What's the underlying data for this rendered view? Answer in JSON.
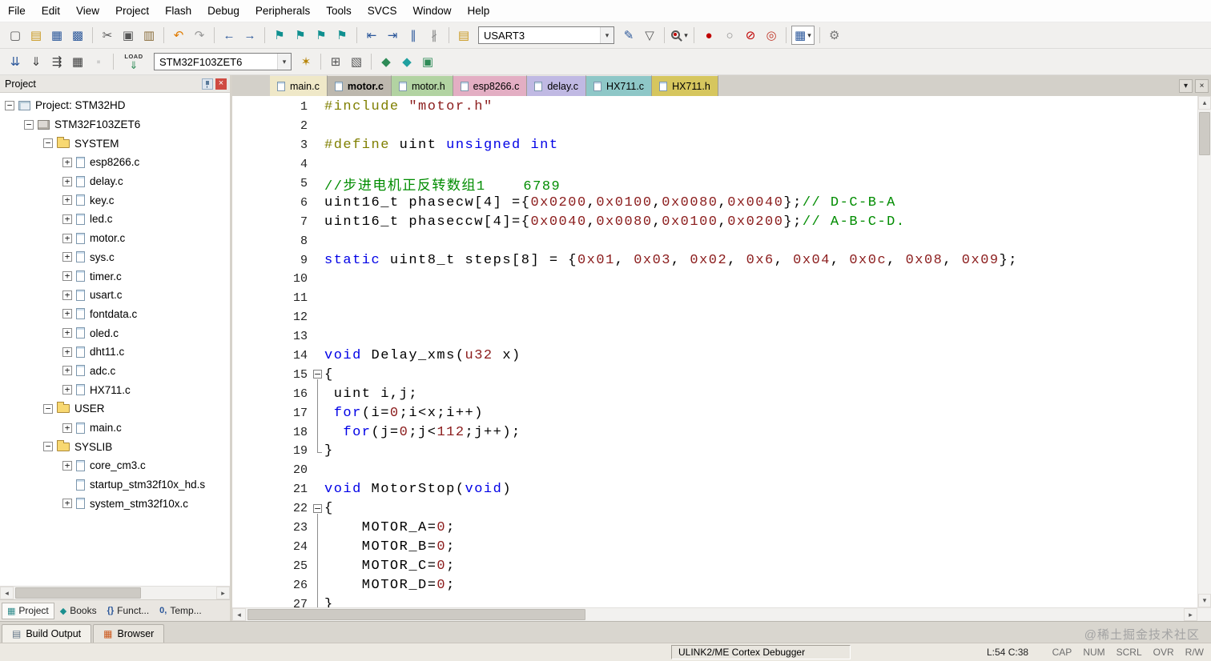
{
  "menu": {
    "items": [
      "File",
      "Edit",
      "View",
      "Project",
      "Flash",
      "Debug",
      "Peripherals",
      "Tools",
      "SVCS",
      "Window",
      "Help"
    ]
  },
  "toolbar_main": {
    "left_icons": [
      {
        "name": "new-file-icon",
        "glyph": "▢",
        "color": "#5a5a5a"
      },
      {
        "name": "open-folder-icon",
        "glyph": "▤",
        "color": "#c9971c"
      },
      {
        "name": "save-icon",
        "glyph": "▦",
        "color": "#2b579a"
      },
      {
        "name": "save-all-icon",
        "glyph": "▩",
        "color": "#2b579a"
      },
      {
        "sep": true
      },
      {
        "name": "cut-icon",
        "glyph": "✂",
        "color": "#555555"
      },
      {
        "name": "copy-icon",
        "glyph": "▣",
        "color": "#555555"
      },
      {
        "name": "paste-icon",
        "glyph": "▥",
        "color": "#8a6d3b"
      },
      {
        "sep": true
      },
      {
        "name": "undo-icon",
        "glyph": "↶",
        "color": "#e07b00"
      },
      {
        "name": "redo-icon",
        "glyph": "↷",
        "color": "#999999"
      },
      {
        "sep": true
      },
      {
        "name": "navigate-back-icon",
        "glyph": "←",
        "color": "#2b579a"
      },
      {
        "name": "navigate-forward-icon",
        "glyph": "→",
        "color": "#2b579a"
      },
      {
        "sep": true
      },
      {
        "name": "bookmark-toggle-icon",
        "glyph": "⚑",
        "color": "#0e8f8f"
      },
      {
        "name": "bookmark-prev-icon",
        "glyph": "⚑",
        "color": "#0e8f8f"
      },
      {
        "name": "bookmark-next-icon",
        "glyph": "⚑",
        "color": "#0e8f8f"
      },
      {
        "name": "bookmark-clear-all-icon",
        "glyph": "⚑",
        "color": "#0e8f8f"
      },
      {
        "sep": true
      },
      {
        "name": "unindent-icon",
        "glyph": "⇤",
        "color": "#2b579a"
      },
      {
        "name": "indent-icon",
        "glyph": "⇥",
        "color": "#2b579a"
      },
      {
        "name": "comment-selection-icon",
        "glyph": "∥",
        "color": "#2b579a"
      },
      {
        "name": "uncomment-selection-icon",
        "glyph": "∦",
        "color": "#888888"
      },
      {
        "sep": true
      },
      {
        "name": "serial-port-icon",
        "glyph": "▤",
        "color": "#c9971c"
      }
    ],
    "serial_combo": {
      "value": "USART3"
    },
    "right_icons": [
      {
        "name": "configure-flags-icon",
        "glyph": "✎",
        "color": "#2b579a"
      },
      {
        "name": "analysis-windows-icon",
        "glyph": "▽",
        "color": "#555555"
      },
      {
        "sep": true
      },
      {
        "name": "find-in-files-icon",
        "glyph": "MAG",
        "color": "#555555",
        "drop": true
      },
      {
        "sep": true
      },
      {
        "name": "insert-breakpoint-icon",
        "glyph": "●",
        "color": "#c00000"
      },
      {
        "name": "enable-breakpoint-icon",
        "glyph": "○",
        "color": "#8a8a8a"
      },
      {
        "name": "disable-all-breakpoints-icon",
        "glyph": "⊘",
        "color": "#c00000"
      },
      {
        "name": "kill-all-breakpoints-icon",
        "glyph": "◎",
        "color": "#c0392b"
      },
      {
        "sep": true
      },
      {
        "name": "debug-windows-icon",
        "glyph": "▦",
        "color": "#2b579a",
        "drop": true,
        "boxed": true
      },
      {
        "sep": true
      },
      {
        "name": "configure-target-icon",
        "glyph": "⚙",
        "color": "#777777"
      }
    ]
  },
  "toolbar_build": {
    "left_icons": [
      {
        "name": "translate-file-icon",
        "glyph": "⇊",
        "color": "#2b579a"
      },
      {
        "name": "build-icon",
        "glyph": "⇓",
        "color": "#3a3a3a"
      },
      {
        "name": "rebuild-all-icon",
        "glyph": "⇶",
        "color": "#3a3a3a"
      },
      {
        "name": "batch-build-icon",
        "glyph": "▦",
        "color": "#3a3a3a"
      },
      {
        "name": "stop-build-icon",
        "glyph": "▪",
        "color": "#9a9a9a",
        "disabled": true
      },
      {
        "sep": true
      },
      {
        "name": "download-icon",
        "load": true
      }
    ],
    "load_label": "LOAD",
    "target_combo": {
      "value": "STM32F103ZET6"
    },
    "right_icons": [
      {
        "name": "target-options-icon",
        "glyph": "✶",
        "color": "#b8860b"
      },
      {
        "sep": true
      },
      {
        "name": "manage-project-items-icon",
        "glyph": "⊞",
        "color": "#555555"
      },
      {
        "name": "file-extensions-icon",
        "glyph": "▧",
        "color": "#555555"
      },
      {
        "sep": true
      },
      {
        "name": "software-packs-icon",
        "glyph": "◆",
        "color": "#2e8b57"
      },
      {
        "name": "manage-run-time-environment-icon",
        "glyph": "◆",
        "color": "#20a0a0"
      },
      {
        "name": "pack-installer-icon",
        "glyph": "▣",
        "color": "#2e8b57"
      }
    ]
  },
  "project_panel": {
    "title": "Project",
    "tree": [
      {
        "label": "Project: STM32HD",
        "level": 0,
        "twisty": "-",
        "icon": "workspace"
      },
      {
        "label": "STM32F103ZET6",
        "level": 1,
        "twisty": "-",
        "icon": "target"
      },
      {
        "label": "SYSTEM",
        "level": 2,
        "twisty": "-",
        "icon": "folder"
      },
      {
        "label": "esp8266.c",
        "level": 3,
        "twisty": "+",
        "icon": "file"
      },
      {
        "label": "delay.c",
        "level": 3,
        "twisty": "+",
        "icon": "file"
      },
      {
        "label": "key.c",
        "level": 3,
        "twisty": "+",
        "icon": "file"
      },
      {
        "label": "led.c",
        "level": 3,
        "twisty": "+",
        "icon": "file"
      },
      {
        "label": "motor.c",
        "level": 3,
        "twisty": "+",
        "icon": "file"
      },
      {
        "label": "sys.c",
        "level": 3,
        "twisty": "+",
        "icon": "file"
      },
      {
        "label": "timer.c",
        "level": 3,
        "twisty": "+",
        "icon": "file"
      },
      {
        "label": "usart.c",
        "level": 3,
        "twisty": "+",
        "icon": "file"
      },
      {
        "label": "fontdata.c",
        "level": 3,
        "twisty": "+",
        "icon": "file"
      },
      {
        "label": "oled.c",
        "level": 3,
        "twisty": "+",
        "icon": "file"
      },
      {
        "label": "dht11.c",
        "level": 3,
        "twisty": "+",
        "icon": "file"
      },
      {
        "label": "adc.c",
        "level": 3,
        "twisty": "+",
        "icon": "file"
      },
      {
        "label": "HX711.c",
        "level": 3,
        "twisty": "+",
        "icon": "file"
      },
      {
        "label": "USER",
        "level": 2,
        "twisty": "-",
        "icon": "folder"
      },
      {
        "label": "main.c",
        "level": 3,
        "twisty": "+",
        "icon": "file"
      },
      {
        "label": "SYSLIB",
        "level": 2,
        "twisty": "-",
        "icon": "folder"
      },
      {
        "label": "core_cm3.c",
        "level": 3,
        "twisty": "+",
        "icon": "file"
      },
      {
        "label": "startup_stm32f10x_hd.s",
        "level": 3,
        "twisty": "",
        "icon": "file"
      },
      {
        "label": "system_stm32f10x.c",
        "level": 3,
        "twisty": "+",
        "icon": "file"
      }
    ],
    "bottom_tabs": [
      {
        "label": "Project",
        "glyph": "▦",
        "color": "#2e8b8b",
        "active": true
      },
      {
        "label": "Books",
        "glyph": "◆",
        "color": "#1a8f8f",
        "active": false
      },
      {
        "label": "Funct...",
        "glyph": "{}",
        "color": "#2b579a",
        "active": false
      },
      {
        "label": "Temp...",
        "glyph": "0,",
        "color": "#2b579a",
        "active": false
      }
    ]
  },
  "editor": {
    "tabs": [
      {
        "label": "main.c",
        "color": "#efe8c8",
        "active": false
      },
      {
        "label": "motor.c",
        "color": "#bdb8ae",
        "active": true
      },
      {
        "label": "motor.h",
        "color": "#b2d3a2",
        "active": false
      },
      {
        "label": "esp8266.c",
        "color": "#e3aec3",
        "active": false
      },
      {
        "label": "delay.c",
        "color": "#c0b9e3",
        "active": false
      },
      {
        "label": "HX711.c",
        "color": "#8ec7c7",
        "active": false
      },
      {
        "label": "HX711.h",
        "color": "#d6c65e",
        "active": false
      }
    ],
    "syntax_colors": {
      "pl": "#000000",
      "kw": "#0000e6",
      "cm": "#008c00",
      "num": "#8b1c1c",
      "str": "#8b1c1c",
      "pp": "#7f7f00",
      "typ": "#8b1c1c"
    },
    "code": [
      {
        "n": 1,
        "fold": "",
        "seg": [
          [
            "pp",
            "#include"
          ],
          [
            "pl",
            " "
          ],
          [
            "str",
            "\"motor.h\""
          ]
        ]
      },
      {
        "n": 2,
        "fold": "",
        "seg": []
      },
      {
        "n": 3,
        "fold": "",
        "seg": [
          [
            "pp",
            "#define"
          ],
          [
            "pl",
            " uint "
          ],
          [
            "kw",
            "unsigned int"
          ]
        ]
      },
      {
        "n": 4,
        "fold": "",
        "seg": []
      },
      {
        "n": 5,
        "fold": "",
        "seg": [
          [
            "cm",
            "//步进电机正反转数组1    6789"
          ]
        ]
      },
      {
        "n": 6,
        "fold": "",
        "seg": [
          [
            "pl",
            "uint16_t phasecw[4] ={"
          ],
          [
            "num",
            "0x0200"
          ],
          [
            "pl",
            ","
          ],
          [
            "num",
            "0x0100"
          ],
          [
            "pl",
            ","
          ],
          [
            "num",
            "0x0080"
          ],
          [
            "pl",
            ","
          ],
          [
            "num",
            "0x0040"
          ],
          [
            "pl",
            "};"
          ],
          [
            "cm",
            "// D-C-B-A"
          ]
        ]
      },
      {
        "n": 7,
        "fold": "",
        "seg": [
          [
            "pl",
            "uint16_t phaseccw[4]={"
          ],
          [
            "num",
            "0x0040"
          ],
          [
            "pl",
            ","
          ],
          [
            "num",
            "0x0080"
          ],
          [
            "pl",
            ","
          ],
          [
            "num",
            "0x0100"
          ],
          [
            "pl",
            ","
          ],
          [
            "num",
            "0x0200"
          ],
          [
            "pl",
            "};"
          ],
          [
            "cm",
            "// A-B-C-D."
          ]
        ]
      },
      {
        "n": 8,
        "fold": "",
        "seg": []
      },
      {
        "n": 9,
        "fold": "",
        "seg": [
          [
            "kw",
            "static"
          ],
          [
            "pl",
            " uint8_t steps[8] = {"
          ],
          [
            "num",
            "0x01"
          ],
          [
            "pl",
            ", "
          ],
          [
            "num",
            "0x03"
          ],
          [
            "pl",
            ", "
          ],
          [
            "num",
            "0x02"
          ],
          [
            "pl",
            ", "
          ],
          [
            "num",
            "0x6"
          ],
          [
            "pl",
            ", "
          ],
          [
            "num",
            "0x04"
          ],
          [
            "pl",
            ", "
          ],
          [
            "num",
            "0x0c"
          ],
          [
            "pl",
            ", "
          ],
          [
            "num",
            "0x08"
          ],
          [
            "pl",
            ", "
          ],
          [
            "num",
            "0x09"
          ],
          [
            "pl",
            "};"
          ]
        ]
      },
      {
        "n": 10,
        "fold": "",
        "seg": []
      },
      {
        "n": 11,
        "fold": "",
        "seg": []
      },
      {
        "n": 12,
        "fold": "",
        "seg": []
      },
      {
        "n": 13,
        "fold": "",
        "seg": []
      },
      {
        "n": 14,
        "fold": "",
        "seg": [
          [
            "kw",
            "void"
          ],
          [
            "pl",
            " Delay_xms("
          ],
          [
            "typ",
            "u32"
          ],
          [
            "pl",
            " x)"
          ]
        ]
      },
      {
        "n": 15,
        "fold": "start",
        "seg": [
          [
            "pl",
            "{"
          ]
        ]
      },
      {
        "n": 16,
        "fold": "mid",
        "seg": [
          [
            "pl",
            " uint i,j;"
          ]
        ]
      },
      {
        "n": 17,
        "fold": "mid",
        "seg": [
          [
            "pl",
            " "
          ],
          [
            "kw",
            "for"
          ],
          [
            "pl",
            "(i="
          ],
          [
            "num",
            "0"
          ],
          [
            "pl",
            ";i<x;i++)"
          ]
        ]
      },
      {
        "n": 18,
        "fold": "mid",
        "seg": [
          [
            "pl",
            "  "
          ],
          [
            "kw",
            "for"
          ],
          [
            "pl",
            "(j="
          ],
          [
            "num",
            "0"
          ],
          [
            "pl",
            ";j<"
          ],
          [
            "num",
            "112"
          ],
          [
            "pl",
            ";j++);"
          ]
        ]
      },
      {
        "n": 19,
        "fold": "end",
        "seg": [
          [
            "pl",
            "}"
          ]
        ]
      },
      {
        "n": 20,
        "fold": "",
        "seg": []
      },
      {
        "n": 21,
        "fold": "",
        "seg": [
          [
            "kw",
            "void"
          ],
          [
            "pl",
            " MotorStop("
          ],
          [
            "kw",
            "void"
          ],
          [
            "pl",
            ")"
          ]
        ]
      },
      {
        "n": 22,
        "fold": "start",
        "seg": [
          [
            "pl",
            "{"
          ]
        ]
      },
      {
        "n": 23,
        "fold": "mid",
        "seg": [
          [
            "pl",
            "    MOTOR_A="
          ],
          [
            "num",
            "0"
          ],
          [
            "pl",
            ";"
          ]
        ]
      },
      {
        "n": 24,
        "fold": "mid",
        "seg": [
          [
            "pl",
            "    MOTOR_B="
          ],
          [
            "num",
            "0"
          ],
          [
            "pl",
            ";"
          ]
        ]
      },
      {
        "n": 25,
        "fold": "mid",
        "seg": [
          [
            "pl",
            "    MOTOR_C="
          ],
          [
            "num",
            "0"
          ],
          [
            "pl",
            ";"
          ]
        ]
      },
      {
        "n": 26,
        "fold": "mid",
        "seg": [
          [
            "pl",
            "    MOTOR_D="
          ],
          [
            "num",
            "0"
          ],
          [
            "pl",
            ";"
          ]
        ]
      },
      {
        "n": 27,
        "fold": "mid",
        "seg": [
          [
            "pl",
            "}"
          ]
        ]
      }
    ]
  },
  "output_bar": {
    "tabs": [
      {
        "label": "Build Output",
        "glyph": "▤",
        "color": "#667788",
        "active": true
      },
      {
        "label": "Browser",
        "glyph": "▦",
        "color": "#cc5a1e",
        "active": false
      }
    ]
  },
  "status_bar": {
    "debugger": "ULINK2/ME Cortex Debugger",
    "cursor": "L:54 C:38",
    "flags": [
      "CAP",
      "NUM",
      "SCRL",
      "OVR",
      "R/W"
    ]
  },
  "watermark": "@稀土掘金技术社区"
}
